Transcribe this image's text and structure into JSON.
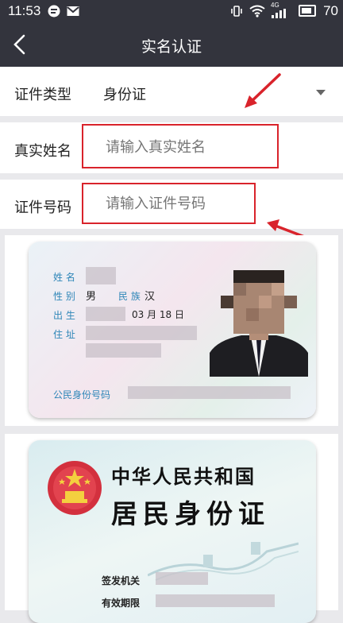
{
  "status": {
    "time": "11:53",
    "network": "4G",
    "battery": "70"
  },
  "header": {
    "title": "实名认证"
  },
  "form": {
    "id_type_label": "证件类型",
    "id_type_value": "身份证",
    "name_label": "真实姓名",
    "name_placeholder": "请输入真实姓名",
    "id_number_label": "证件号码",
    "id_number_placeholder": "请输入证件号码"
  },
  "id_front": {
    "name_label": "姓 名",
    "gender_label": "性 别",
    "gender_value": "男",
    "ethnicity_label": "民 族",
    "ethnicity_value": "汉",
    "birth_label": "出 生",
    "birth_value": "03 月 18 日",
    "address_label": "住 址",
    "id_number_label": "公民身份号码"
  },
  "id_back": {
    "country": "中华人民共和国",
    "card_title": "居民身份证",
    "authority_label": "签发机关",
    "validity_label": "有效期限"
  },
  "colors": {
    "header_bg": "#33343d",
    "annotation_red": "#d9232b",
    "card_label_blue": "#2e86b8"
  }
}
